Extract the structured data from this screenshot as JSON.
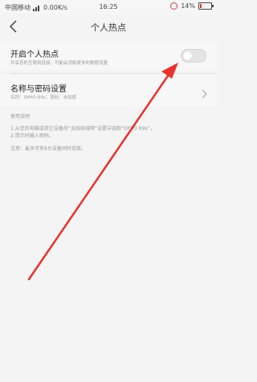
{
  "status_bar": {
    "carrier": "中国移动",
    "speed": "0.00K/s",
    "time": "16:25",
    "battery": "14%",
    "battery_level": 0.14
  },
  "header": {
    "title": "个人热点"
  },
  "hotspot": {
    "label": "开启个人热点",
    "description": "共享您的互联网连接，可能会消耗更多的数据流量",
    "enabled": false
  },
  "name_password": {
    "label": "名称与密码设置",
    "description": "名称：OPPO R9s；密码：未加密"
  },
  "help": {
    "title": "使用说明",
    "step1": "1.从您的电脑或其它设备的“无线局域网”设置中选取“OPPO R9s”。",
    "step2": "2.提示时输入密码。",
    "note": "注意：最多可有8台设备同时连接。"
  },
  "colors": {
    "background": "#f4f4f4",
    "annotation_arrow": "#e8322f",
    "toggle_off": "#e4e4e4"
  }
}
